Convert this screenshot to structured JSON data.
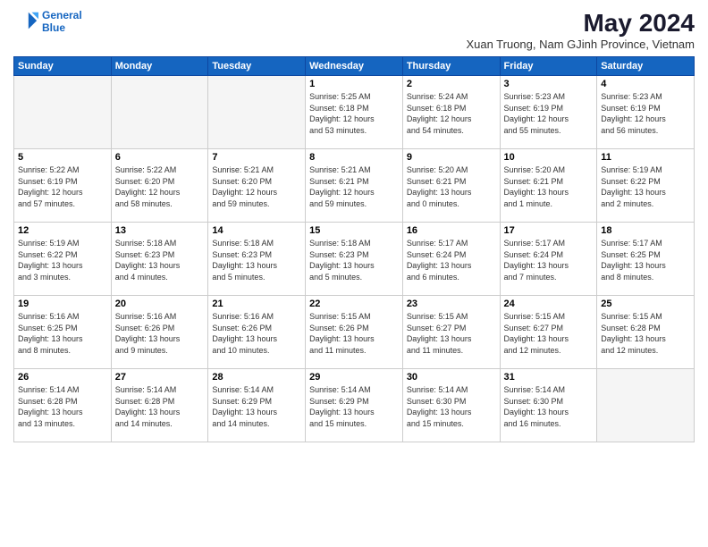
{
  "logo": {
    "line1": "General",
    "line2": "Blue"
  },
  "title": "May 2024",
  "subtitle": "Xuan Truong, Nam GJinh Province, Vietnam",
  "days_header": [
    "Sunday",
    "Monday",
    "Tuesday",
    "Wednesday",
    "Thursday",
    "Friday",
    "Saturday"
  ],
  "weeks": [
    [
      {
        "num": "",
        "info": ""
      },
      {
        "num": "",
        "info": ""
      },
      {
        "num": "",
        "info": ""
      },
      {
        "num": "1",
        "info": "Sunrise: 5:25 AM\nSunset: 6:18 PM\nDaylight: 12 hours\nand 53 minutes."
      },
      {
        "num": "2",
        "info": "Sunrise: 5:24 AM\nSunset: 6:18 PM\nDaylight: 12 hours\nand 54 minutes."
      },
      {
        "num": "3",
        "info": "Sunrise: 5:23 AM\nSunset: 6:19 PM\nDaylight: 12 hours\nand 55 minutes."
      },
      {
        "num": "4",
        "info": "Sunrise: 5:23 AM\nSunset: 6:19 PM\nDaylight: 12 hours\nand 56 minutes."
      }
    ],
    [
      {
        "num": "5",
        "info": "Sunrise: 5:22 AM\nSunset: 6:19 PM\nDaylight: 12 hours\nand 57 minutes."
      },
      {
        "num": "6",
        "info": "Sunrise: 5:22 AM\nSunset: 6:20 PM\nDaylight: 12 hours\nand 58 minutes."
      },
      {
        "num": "7",
        "info": "Sunrise: 5:21 AM\nSunset: 6:20 PM\nDaylight: 12 hours\nand 59 minutes."
      },
      {
        "num": "8",
        "info": "Sunrise: 5:21 AM\nSunset: 6:21 PM\nDaylight: 12 hours\nand 59 minutes."
      },
      {
        "num": "9",
        "info": "Sunrise: 5:20 AM\nSunset: 6:21 PM\nDaylight: 13 hours\nand 0 minutes."
      },
      {
        "num": "10",
        "info": "Sunrise: 5:20 AM\nSunset: 6:21 PM\nDaylight: 13 hours\nand 1 minute."
      },
      {
        "num": "11",
        "info": "Sunrise: 5:19 AM\nSunset: 6:22 PM\nDaylight: 13 hours\nand 2 minutes."
      }
    ],
    [
      {
        "num": "12",
        "info": "Sunrise: 5:19 AM\nSunset: 6:22 PM\nDaylight: 13 hours\nand 3 minutes."
      },
      {
        "num": "13",
        "info": "Sunrise: 5:18 AM\nSunset: 6:23 PM\nDaylight: 13 hours\nand 4 minutes."
      },
      {
        "num": "14",
        "info": "Sunrise: 5:18 AM\nSunset: 6:23 PM\nDaylight: 13 hours\nand 5 minutes."
      },
      {
        "num": "15",
        "info": "Sunrise: 5:18 AM\nSunset: 6:23 PM\nDaylight: 13 hours\nand 5 minutes."
      },
      {
        "num": "16",
        "info": "Sunrise: 5:17 AM\nSunset: 6:24 PM\nDaylight: 13 hours\nand 6 minutes."
      },
      {
        "num": "17",
        "info": "Sunrise: 5:17 AM\nSunset: 6:24 PM\nDaylight: 13 hours\nand 7 minutes."
      },
      {
        "num": "18",
        "info": "Sunrise: 5:17 AM\nSunset: 6:25 PM\nDaylight: 13 hours\nand 8 minutes."
      }
    ],
    [
      {
        "num": "19",
        "info": "Sunrise: 5:16 AM\nSunset: 6:25 PM\nDaylight: 13 hours\nand 8 minutes."
      },
      {
        "num": "20",
        "info": "Sunrise: 5:16 AM\nSunset: 6:26 PM\nDaylight: 13 hours\nand 9 minutes."
      },
      {
        "num": "21",
        "info": "Sunrise: 5:16 AM\nSunset: 6:26 PM\nDaylight: 13 hours\nand 10 minutes."
      },
      {
        "num": "22",
        "info": "Sunrise: 5:15 AM\nSunset: 6:26 PM\nDaylight: 13 hours\nand 11 minutes."
      },
      {
        "num": "23",
        "info": "Sunrise: 5:15 AM\nSunset: 6:27 PM\nDaylight: 13 hours\nand 11 minutes."
      },
      {
        "num": "24",
        "info": "Sunrise: 5:15 AM\nSunset: 6:27 PM\nDaylight: 13 hours\nand 12 minutes."
      },
      {
        "num": "25",
        "info": "Sunrise: 5:15 AM\nSunset: 6:28 PM\nDaylight: 13 hours\nand 12 minutes."
      }
    ],
    [
      {
        "num": "26",
        "info": "Sunrise: 5:14 AM\nSunset: 6:28 PM\nDaylight: 13 hours\nand 13 minutes."
      },
      {
        "num": "27",
        "info": "Sunrise: 5:14 AM\nSunset: 6:28 PM\nDaylight: 13 hours\nand 14 minutes."
      },
      {
        "num": "28",
        "info": "Sunrise: 5:14 AM\nSunset: 6:29 PM\nDaylight: 13 hours\nand 14 minutes."
      },
      {
        "num": "29",
        "info": "Sunrise: 5:14 AM\nSunset: 6:29 PM\nDaylight: 13 hours\nand 15 minutes."
      },
      {
        "num": "30",
        "info": "Sunrise: 5:14 AM\nSunset: 6:30 PM\nDaylight: 13 hours\nand 15 minutes."
      },
      {
        "num": "31",
        "info": "Sunrise: 5:14 AM\nSunset: 6:30 PM\nDaylight: 13 hours\nand 16 minutes."
      },
      {
        "num": "",
        "info": ""
      }
    ]
  ]
}
